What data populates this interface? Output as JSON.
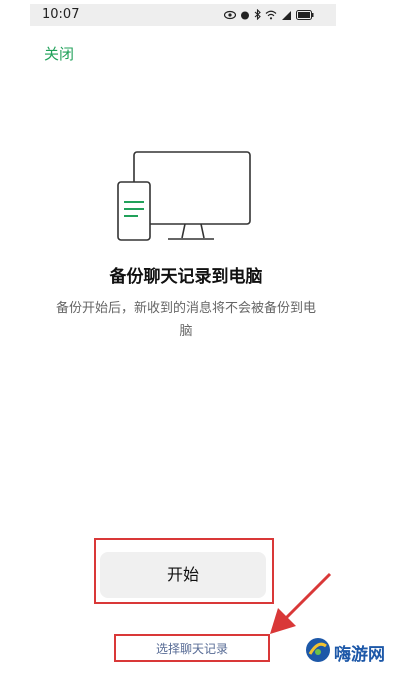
{
  "status_bar": {
    "time": "10:07",
    "icons": [
      "eye-icon",
      "alarm-icon",
      "bluetooth-icon",
      "wifi-icon",
      "signal-icon",
      "battery-icon"
    ]
  },
  "header": {
    "close_label": "关闭"
  },
  "main": {
    "title": "备份聊天记录到电脑",
    "description": "备份开始后，新收到的消息将不会被备份到电脑"
  },
  "actions": {
    "start_label": "开始",
    "select_label": "选择聊天记录"
  },
  "watermark": {
    "text": "嗨游网"
  },
  "colors": {
    "accent_green": "#21a15a",
    "link_blue": "#576b95",
    "annotation_red": "#d93838"
  }
}
